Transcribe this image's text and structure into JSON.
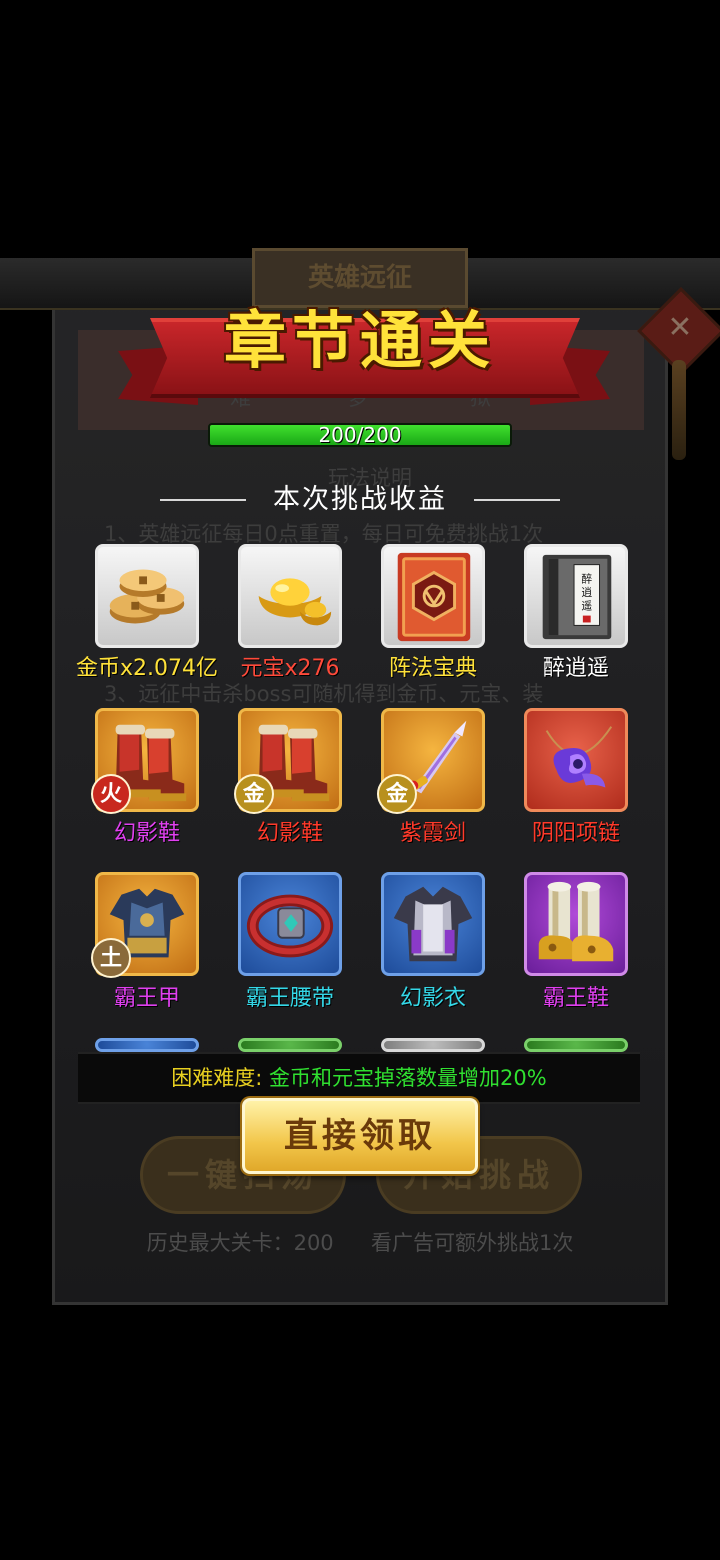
{
  "background": {
    "panel_title": "英雄远征",
    "tabs": [
      "难",
      "梦",
      "狱"
    ],
    "rules_heading": "玩法说明",
    "rules_lines": [
      "1、英雄远征每日0点重置，每日可免费挑战1次",
      "3、远征中击杀boss可随机得到金币、元宝、装"
    ],
    "sweep_button": "一键扫荡",
    "start_button": "开始挑战",
    "history_label": "历史最大关卡：200",
    "ad_label": "看广告可额外挑战1次"
  },
  "popup": {
    "title": "章节通关",
    "progress": {
      "text": "200/200",
      "current": 200,
      "max": 200
    },
    "rewards_title": "本次挑战收益",
    "items": [
      {
        "label": "金币x2.074亿",
        "icon": "gold-coins-icon",
        "frame": "white",
        "label_color": "#ffe23a"
      },
      {
        "label": "元宝x276",
        "icon": "gold-ingot-icon",
        "frame": "white",
        "label_color": "#ff4a3a"
      },
      {
        "label": "阵法宝典",
        "icon": "formation-book-icon",
        "frame": "white",
        "label_color": "#ffe23a"
      },
      {
        "label": "醉逍遥",
        "icon": "scroll-book-icon",
        "frame": "white",
        "label_color": "#ffffff",
        "book_text": "醉逍遥"
      },
      {
        "label": "幻影鞋",
        "icon": "boots-icon",
        "frame": "orange",
        "label_color": "#e040f0",
        "badge": "火",
        "badge_color": "#c8281e"
      },
      {
        "label": "幻影鞋",
        "icon": "boots-icon",
        "frame": "orange",
        "label_color": "#ff3a2a",
        "badge": "金",
        "badge_color": "#b8901e"
      },
      {
        "label": "紫霞剑",
        "icon": "sword-icon",
        "frame": "orange",
        "label_color": "#ff3a2a",
        "badge": "金",
        "badge_color": "#b8901e"
      },
      {
        "label": "阴阳项链",
        "icon": "necklace-icon",
        "frame": "red",
        "label_color": "#ff3a2a"
      },
      {
        "label": "霸王甲",
        "icon": "armor-icon",
        "frame": "orange",
        "label_color": "#e040f0",
        "badge": "土",
        "badge_color": "#8a6a3a"
      },
      {
        "label": "霸王腰带",
        "icon": "belt-icon",
        "frame": "blue",
        "label_color": "#34d8e8"
      },
      {
        "label": "幻影衣",
        "icon": "robe-icon",
        "frame": "blue",
        "label_color": "#34d8e8"
      },
      {
        "label": "霸王鞋",
        "icon": "golden-boots-icon",
        "frame": "purple",
        "label_color": "#e040f0"
      }
    ],
    "partial_row_frames": [
      "blue",
      "green",
      "grey",
      "green"
    ],
    "difficulty": {
      "prefix": "困难难度:",
      "text": "金币和元宝掉落数量增加20%",
      "prefix_color": "#e8d020",
      "text_color": "#30e030"
    },
    "claim_button": "直接领取"
  }
}
